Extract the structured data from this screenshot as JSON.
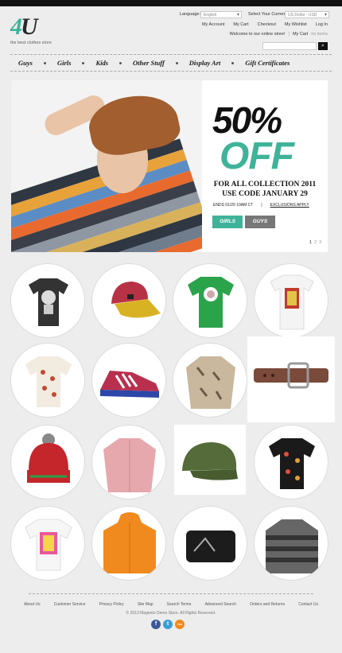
{
  "header": {
    "logo_text": "4U",
    "tagline": "the best clothes store",
    "language_label": "Language:",
    "language_value": "English",
    "currency_label": "Select Your Currency:",
    "currency_value": "US Dollar - USD",
    "links": [
      "My Account",
      "My Cart",
      "Checkout",
      "My Wishlist",
      "Log In"
    ],
    "welcome": "Welcome to our online store!",
    "cart_label": "My Cart",
    "cart_value": "no items"
  },
  "nav": {
    "items": [
      "Guys",
      "Girls",
      "Kids",
      "Other Stuff",
      "Display Art",
      "Gift Certificates"
    ]
  },
  "banner": {
    "percent": "50%",
    "off": "OFF",
    "line1": "FOR ALL COLLECTION 2011",
    "line2": "USE CODE JANUARY 29",
    "ends": "ENDS 01/29 10AM CT",
    "divider": "|",
    "exclusions": "EXCLUSIONS APPLY",
    "btn_girls": "GIRLS",
    "btn_guys": "GUYS",
    "pages": [
      "1",
      "2",
      "3"
    ]
  },
  "products": [
    {
      "name": "Skull T-Shirt"
    },
    {
      "name": "Red Cap"
    },
    {
      "name": "Green T-Shirt"
    },
    {
      "name": "White Print T-Shirt"
    },
    {
      "name": "Pattern T-Shirt"
    },
    {
      "name": "Sneakers"
    },
    {
      "name": "Print Shirt"
    },
    {
      "name": "Leather Belt"
    },
    {
      "name": "Beanie"
    },
    {
      "name": "Pink Shirt"
    },
    {
      "name": "Olive Cap"
    },
    {
      "name": "Floral T-Shirt"
    },
    {
      "name": "Real T-Shirt"
    },
    {
      "name": "Orange Jacket"
    },
    {
      "name": "Wallet"
    },
    {
      "name": "Striped Sweater"
    }
  ],
  "footer": {
    "links": [
      "About Us",
      "Customer Service",
      "Privacy Policy",
      "Site Map",
      "Search Terms",
      "Advanced Search",
      "Orders and Returns",
      "Contact Us"
    ],
    "copyright": "© 2013 Magento Demo Store. All Rights Reserved.",
    "social": [
      "f",
      "t",
      "rss"
    ]
  },
  "colors": {
    "accent": "#3fb39a",
    "dark": "#111111",
    "background": "#ededed"
  }
}
